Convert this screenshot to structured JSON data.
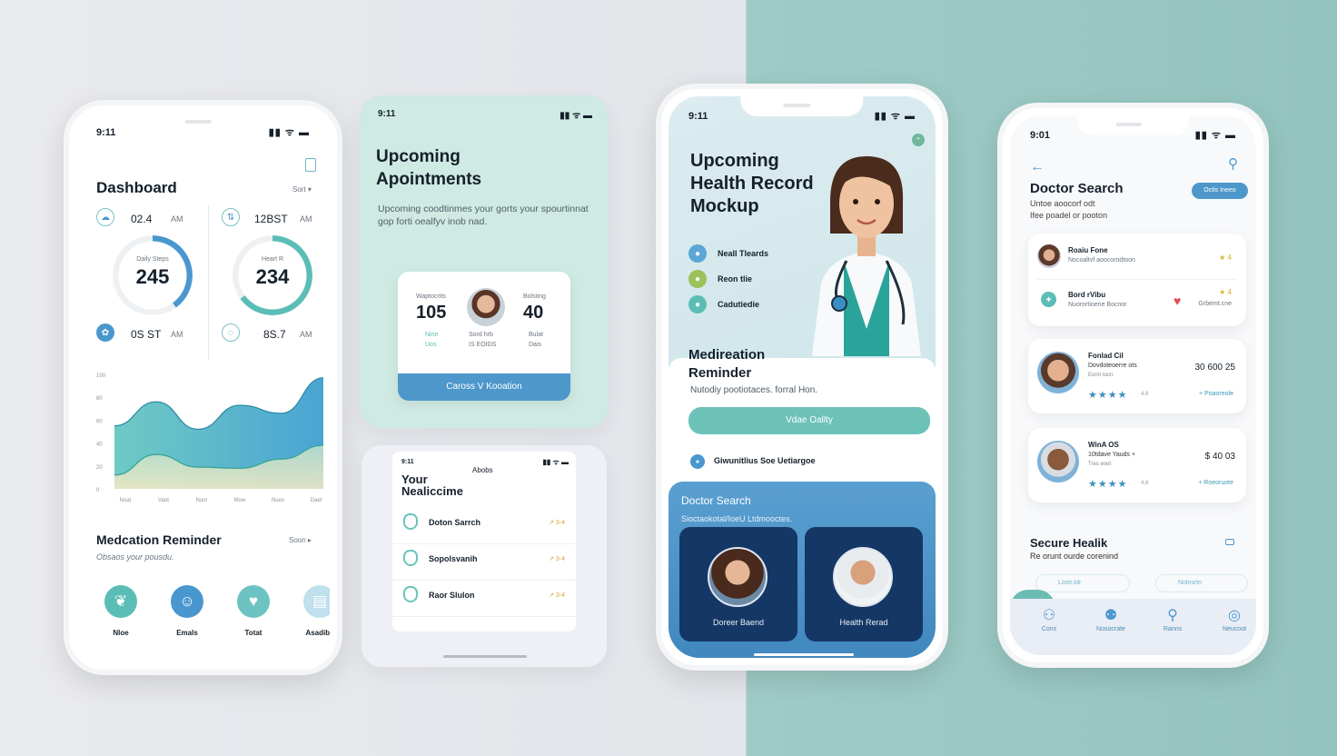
{
  "dashboard_phone": {
    "time": "9:11",
    "signal": "▮▮ ᯤ ▬",
    "title": "Dashboard",
    "sort": "Sort ▾",
    "stats": [
      {
        "value": "02.4",
        "unit": "AM"
      },
      {
        "value": "12BST",
        "unit": "AM"
      },
      {
        "value": "0S ST",
        "unit": "AM"
      },
      {
        "value": "8S.7",
        "unit": "AM"
      }
    ],
    "rings": [
      {
        "label": "Daily Steps",
        "value": "245",
        "progress": 0.4,
        "color": "#4a97cf"
      },
      {
        "label": "Heart R",
        "value": "234",
        "progress": 0.65,
        "color": "#5bbdb5"
      }
    ],
    "chart": {
      "y_ticks": [
        "100",
        "80",
        "60",
        "40",
        "20",
        "0"
      ],
      "x_ticks": [
        "Noat",
        "Vaot",
        "Nuor",
        "Mow",
        "Nuos",
        "Daet"
      ],
      "ylim": [
        0,
        100
      ],
      "series": [
        {
          "values": [
            55,
            76,
            52,
            73,
            66,
            97
          ],
          "color": "#5bbfc6"
        },
        {
          "values": [
            12,
            30,
            19,
            18,
            26,
            38
          ],
          "color": "#f3e2b3"
        }
      ]
    },
    "med_title": "Medcation Reminder",
    "med_more": "Soon ▸",
    "med_sub": "Obsaos your pousdu.",
    "shortcuts": [
      {
        "label": "Nloe",
        "icon": "heart-hands-icon"
      },
      {
        "label": "Emals",
        "icon": "robot-icon"
      },
      {
        "label": "Totat",
        "icon": "heart-icon"
      },
      {
        "label": "Asadibe",
        "icon": "clipboard-icon"
      }
    ]
  },
  "appointments_card": {
    "time": "9:11",
    "title_1": "Upcoming",
    "title_2": "Apointments",
    "desc": "Upcoming coodtinmes your gorts your spourtinnat gop forti oealfyv inob nad.",
    "left_label": "Waptocrits",
    "left_value": "105",
    "left_sub1": "Nine",
    "left_sub2": "Uos",
    "mid_sub1": "Sord hrb",
    "mid_sub2": "IS EOIDS",
    "right_label": "Bolsting",
    "right_value": "40",
    "right_sub1": "Bulat",
    "right_sub2": "Dais",
    "button": "Caross V Kooation"
  },
  "healthtime_card": {
    "time": "9:11",
    "center": "Abobs",
    "title_1": "Your",
    "title_2": "Nealiccime",
    "items": [
      {
        "label": "Doton Sarrch",
        "trend": "↗ 3-4"
      },
      {
        "label": "Sopolsvanih",
        "trend": "↗ 3-4"
      },
      {
        "label": "Raor Slulon",
        "trend": "↗ 3-4"
      }
    ]
  },
  "record_phone": {
    "time": "9:11",
    "title_1": "Upcoming",
    "title_2": "Health Record",
    "title_3": "Mockup",
    "features": [
      {
        "label": "Neall Tleards",
        "color": "#5aa6d6"
      },
      {
        "label": "Reon tlie",
        "color": "#9cc35a"
      },
      {
        "label": "Cadutiedie",
        "color": "#5bbdb5"
      }
    ],
    "med_title_1": "Medireation",
    "med_title_2": "Reminder",
    "med_sub": "Nutodiy pootiotaces. forral Hon.",
    "button": "Vdae Oallty",
    "note": "Giwunitlius Soe Uetiargoe",
    "search_title": "Doctor Search",
    "search_sub": "Sioctaokotal/IoeU Ltdmooctes.",
    "doctors": [
      {
        "label": "Doreer Baend"
      },
      {
        "label": "Health Rerad"
      }
    ]
  },
  "search_phone": {
    "time": "9:01",
    "title": "Doctor Search",
    "chip": "Octis Ineeo",
    "sub_1": "Untoe aoocorf odt",
    "sub_2": "Ifee poadel or pooton",
    "mini": [
      {
        "name": "Roaiu Fone",
        "desc": "Nocoaltvf aoocorodtoon",
        "meta": "★ 4"
      },
      {
        "name": "Bord rVibu",
        "desc": "Nuorortioene Bocnor",
        "meta": "★ 4",
        "extra": "Grbemt.cne"
      }
    ],
    "doctors": [
      {
        "name": "Fonlad Cil",
        "desc": "Dovdoteoerre ots",
        "desc2": "Eorm tocn",
        "price": "30 600 25",
        "rating": "4.8",
        "action": "+ Poaoreole"
      },
      {
        "name": "WinA OS",
        "desc": "10tdave Yauds +",
        "desc2": "Tres eoet",
        "price": "$ 40 03",
        "rating": "4.8",
        "action": "+ Roeoruote"
      }
    ],
    "secure_title": "Secure Healik",
    "secure_sub": "Re orunt ourde corenind",
    "pill_1": "Lostr.tdr",
    "pill_2": "Nolnsrtn",
    "nav": [
      {
        "label": "Cons",
        "icon": "user-icon"
      },
      {
        "label": "Nosocrate",
        "icon": "group-icon"
      },
      {
        "label": "Ranns",
        "icon": "search-icon"
      },
      {
        "label": "Neucoot",
        "icon": "account-icon"
      }
    ]
  }
}
